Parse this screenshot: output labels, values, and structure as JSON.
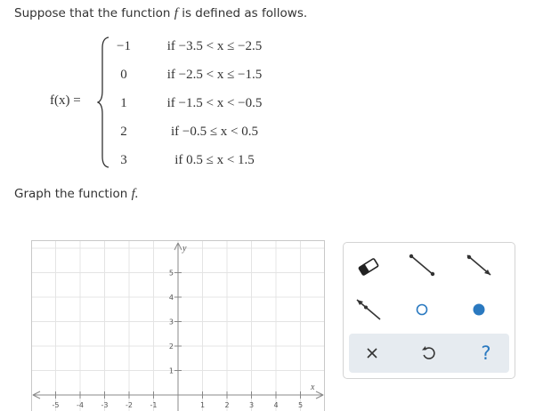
{
  "question": {
    "prompt": "Suppose that the function",
    "fname": "f",
    "prompt_end": "is defined as follows.",
    "lhs": "f(x) =",
    "pieces": [
      {
        "value": "−1",
        "condition": "if −3.5 < x ≤ −2.5"
      },
      {
        "value": "0",
        "condition": "if −2.5 < x ≤ −1.5"
      },
      {
        "value": "1",
        "condition": "if −1.5 < x < −0.5"
      },
      {
        "value": "2",
        "condition": "if −0.5 ≤ x < 0.5"
      },
      {
        "value": "3",
        "condition": "if 0.5 ≤ x < 1.5"
      }
    ],
    "graph_prompt": "Graph the function",
    "graph_fname": "f."
  },
  "graph": {
    "x_axis_label": "x",
    "y_axis_label": "y",
    "x_ticks": [
      "-5",
      "-4",
      "-3",
      "-2",
      "-1",
      "1",
      "2",
      "3",
      "4",
      "5"
    ],
    "y_ticks": [
      "1",
      "2",
      "3",
      "4",
      "5"
    ]
  },
  "tools": {
    "eraser": "eraser-icon",
    "segment": "segment-icon",
    "ray": "ray-icon",
    "line": "line-icon",
    "open_point": "open-circle-icon",
    "closed_point": "closed-circle-icon",
    "clear_label": "×",
    "undo": "undo-icon",
    "help_label": "?"
  },
  "colors": {
    "accent": "#2a79c0",
    "grid": "#e4e4e4",
    "axis": "#888888",
    "panel_bg": "#e6ebf0"
  }
}
